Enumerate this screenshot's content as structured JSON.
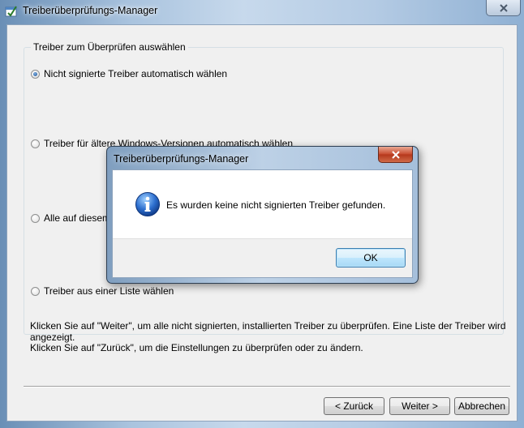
{
  "window": {
    "title": "Treiberüberprüfungs-Manager",
    "group_title": "Treiber zum Überprüfen auswählen",
    "options": [
      {
        "label": "Nicht signierte Treiber automatisch wählen",
        "selected": true
      },
      {
        "label": "Treiber für ältere Windows-Versionen automatisch wählen",
        "selected": false
      },
      {
        "label": "Alle auf diesem C",
        "selected": false
      },
      {
        "label": "Treiber aus einer Liste wählen",
        "selected": false
      }
    ],
    "info_next": "Klicken Sie auf \"Weiter\", um alle nicht signierten, installierten Treiber zu überprüfen. Eine Liste der Treiber wird angezeigt.",
    "info_back": "Klicken Sie auf \"Zurück\", um die Einstellungen zu überprüfen oder zu ändern.",
    "buttons": {
      "back": "< Zurück",
      "next": "Weiter >",
      "cancel": "Abbrechen"
    }
  },
  "dialog": {
    "title": "Treiberüberprüfungs-Manager",
    "message": "Es wurden keine nicht signierten Treiber gefunden.",
    "ok": "OK"
  }
}
